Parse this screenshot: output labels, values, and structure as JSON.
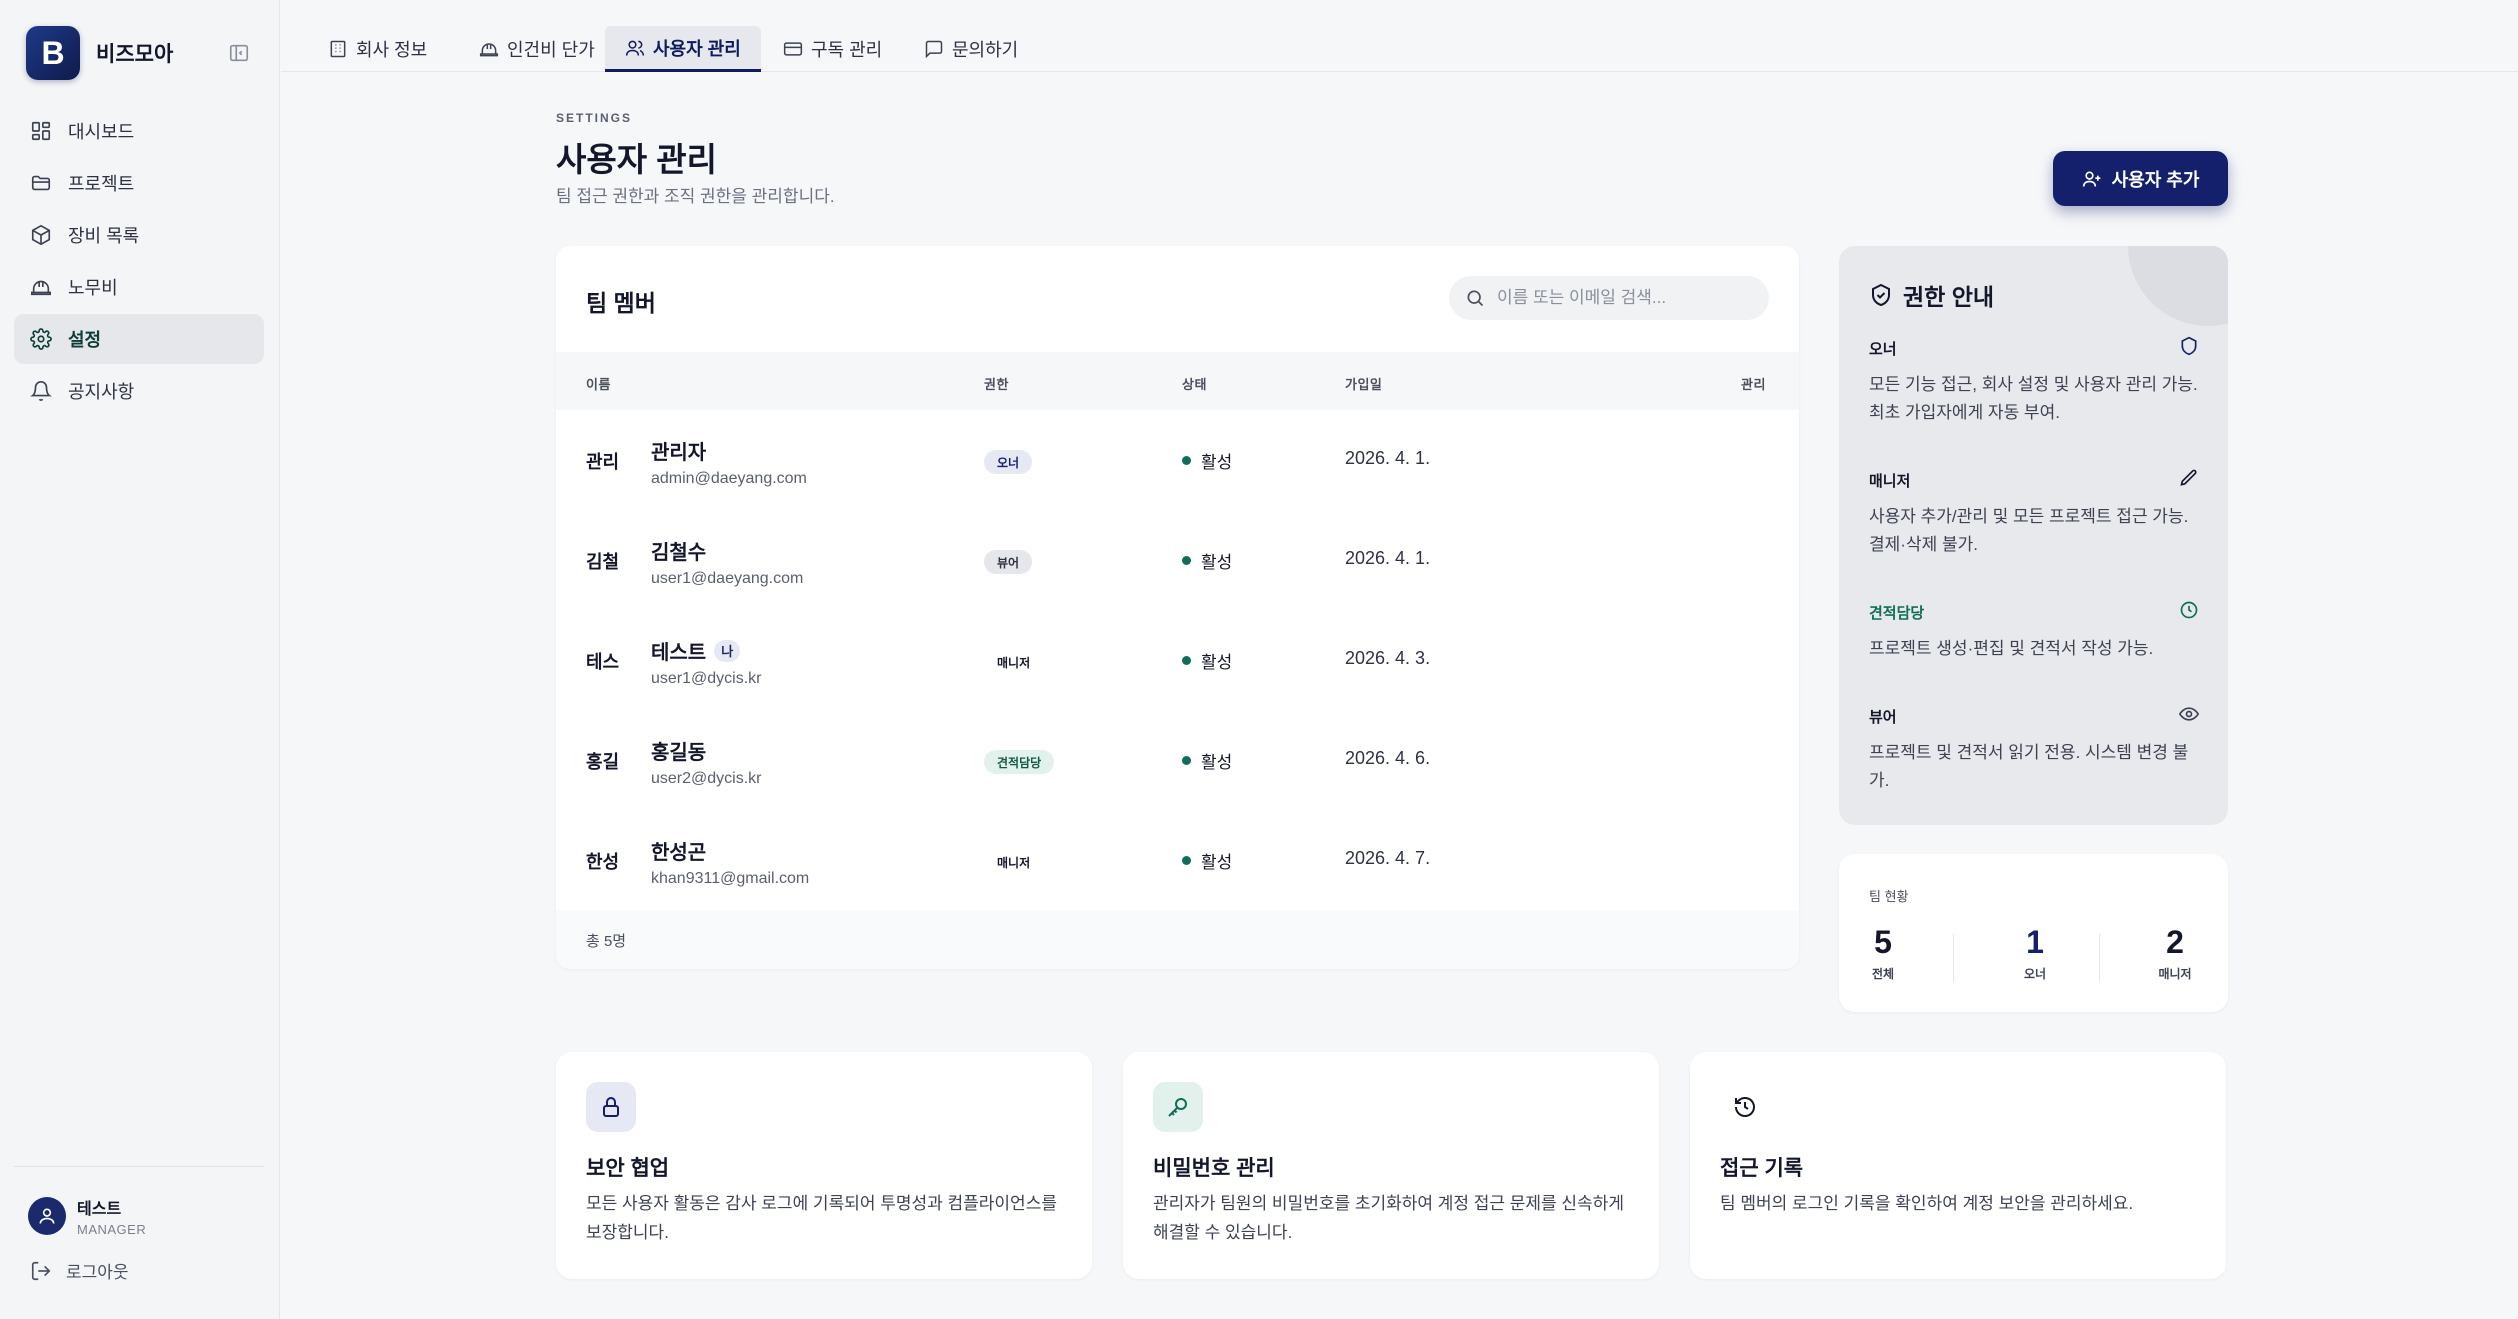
{
  "brand": {
    "logo_letter": "B",
    "name": "비즈모아"
  },
  "sidebar": {
    "items": [
      {
        "label": "대시보드",
        "icon": "dashboard-icon"
      },
      {
        "label": "프로젝트",
        "icon": "folder-icon"
      },
      {
        "label": "장비 목록",
        "icon": "box-icon"
      },
      {
        "label": "노무비",
        "icon": "hard-hat-icon"
      },
      {
        "label": "설정",
        "icon": "gear-icon",
        "active": true
      },
      {
        "label": "공지사항",
        "icon": "bell-icon"
      }
    ],
    "user": {
      "name": "테스트",
      "role": "MANAGER"
    },
    "logout_label": "로그아웃"
  },
  "tabs": [
    {
      "label": "회사 정보"
    },
    {
      "label": "인건비 단가"
    },
    {
      "label": "사용자 관리",
      "active": true
    },
    {
      "label": "구독 관리"
    },
    {
      "label": "문의하기"
    }
  ],
  "header": {
    "eyebrow": "SETTINGS",
    "title": "사용자 관리",
    "subtitle": "팀 접근 권한과 조직 권한을 관리합니다.",
    "add_button": "사용자 추가"
  },
  "members": {
    "title": "팀 멤버",
    "search_placeholder": "이름 또는 이메일 검색...",
    "columns": [
      "이름",
      "권한",
      "상태",
      "가입일",
      "관리"
    ],
    "rows": [
      {
        "avatar": "관리",
        "name": "관리자",
        "email": "admin@daeyang.com",
        "role": "오너",
        "role_type": "owner",
        "status": "활성",
        "joined": "2026. 4. 1.",
        "me": ""
      },
      {
        "avatar": "김철",
        "name": "김철수",
        "email": "user1@daeyang.com",
        "role": "뷰어",
        "role_type": "viewer",
        "status": "활성",
        "joined": "2026. 4. 1.",
        "me": ""
      },
      {
        "avatar": "테스",
        "name": "테스트",
        "email": "user1@dycis.kr",
        "role": "매니저",
        "role_type": "manager",
        "status": "활성",
        "joined": "2026. 4. 3.",
        "me": "나"
      },
      {
        "avatar": "홍길",
        "name": "홍길동",
        "email": "user2@dycis.kr",
        "role": "견적담당",
        "role_type": "estimator",
        "status": "활성",
        "joined": "2026. 4. 6.",
        "me": ""
      },
      {
        "avatar": "한성",
        "name": "한성곤",
        "email": "khan9311@gmail.com",
        "role": "매니저",
        "role_type": "manager",
        "status": "활성",
        "joined": "2026. 4. 7.",
        "me": ""
      }
    ],
    "total": "총 5명"
  },
  "permissions": {
    "title": "권한 안내",
    "items": [
      {
        "name": "오너",
        "desc": "모든 기능 접근, 회사 설정 및 사용자 관리 가능. 최초 가입자에게 자동 부여.",
        "icon": "shield-icon"
      },
      {
        "name": "매니저",
        "desc": "사용자 추가/관리 및 모든 프로젝트 접근 가능. 결제·삭제 불가.",
        "icon": "pencil-icon"
      },
      {
        "name": "견적담당",
        "desc": "프로젝트 생성·편집 및 견적서 작성 가능.",
        "icon": "clock-icon"
      },
      {
        "name": "뷰어",
        "desc": "프로젝트 및 견적서 읽기 전용. 시스템 변경 불가.",
        "icon": "eye-icon"
      }
    ]
  },
  "team_stats": {
    "label": "팀 현황",
    "stats": [
      {
        "value": "5",
        "label": "전체"
      },
      {
        "value": "1",
        "label": "오너"
      },
      {
        "value": "2",
        "label": "매니저"
      }
    ]
  },
  "info_cards": [
    {
      "title": "보안 협업",
      "desc": "모든 사용자 활동은 감사 로그에 기록되어 투명성과 컴플라이언스를 보장합니다.",
      "icon": "lock-icon"
    },
    {
      "title": "비밀번호 관리",
      "desc": "관리자가 팀원의 비밀번호를 초기화하여 계정 접근 문제를 신속하게 해결할 수 있습니다.",
      "icon": "key-icon"
    },
    {
      "title": "접근 기록",
      "desc": "팀 멤버의 로그인 기록을 확인하여 계정 보안을 관리하세요.",
      "icon": "history-icon"
    }
  ],
  "colors": {
    "navy": "#14206b",
    "teal": "#0f6e58",
    "bg": "#f6f7f9"
  }
}
